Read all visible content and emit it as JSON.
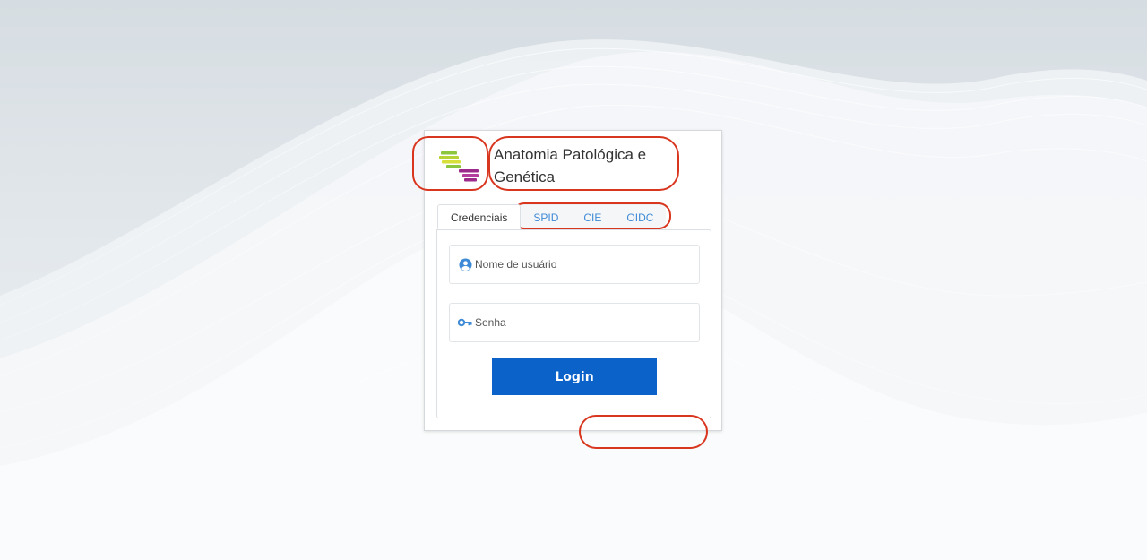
{
  "app": {
    "title": "Anatomia Patológica e Genética"
  },
  "tabs": [
    {
      "label": "Credenciais",
      "active": true
    },
    {
      "label": "SPID",
      "active": false
    },
    {
      "label": "CIE",
      "active": false
    },
    {
      "label": "OIDC",
      "active": false
    }
  ],
  "form": {
    "username": {
      "placeholder": "Nome de usuário",
      "value": "",
      "icon": "user-circle-icon"
    },
    "password": {
      "placeholder": "Senha",
      "value": "",
      "icon": "key-icon"
    },
    "login_label": "Login"
  },
  "colors": {
    "accent": "#0b63c9",
    "link": "#3f8ad6",
    "annotation": "#d9361f",
    "logo_green": "#8cc63f",
    "logo_yellow": "#d7e03a",
    "logo_purple": "#9b2a8a"
  }
}
